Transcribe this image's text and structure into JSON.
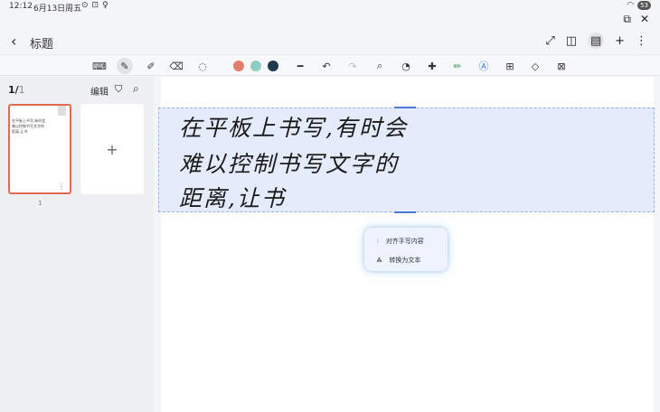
{
  "status": {
    "time": "12:12",
    "date": "6月13日周五",
    "battery": "53"
  },
  "header": {
    "title": "标题"
  },
  "sidebar": {
    "current_page": "1/",
    "total_pages": "1",
    "edit_label": "编辑",
    "page_number": "1",
    "add_page": "+"
  },
  "note": {
    "line1": "在平板上书写,有时会",
    "line2": "难以控制书写文字的",
    "line3": "距离,让书"
  },
  "popup": {
    "align_label": "对齐手写内容",
    "convert_label": "转换为文本"
  },
  "colors": {
    "pen1": "#e07f6b",
    "pen2": "#8dcdc4",
    "pen3": "#1f3b4c",
    "accent": "#e06a4f"
  }
}
